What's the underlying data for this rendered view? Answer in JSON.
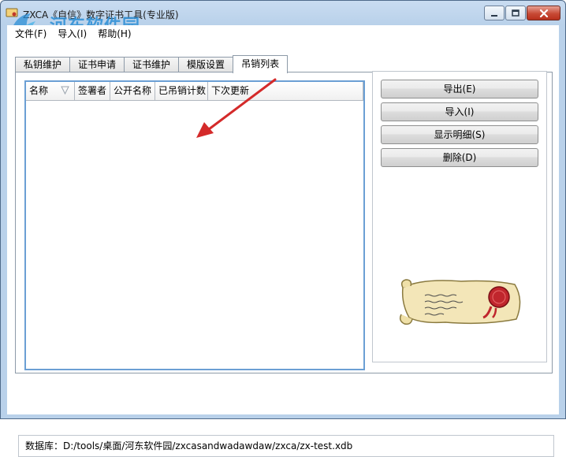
{
  "window": {
    "title": "ZXCA《自信》数字证书工具(专业版)",
    "watermark_name": "河东软件园",
    "watermark_url": "www.pc0359.cn"
  },
  "menu": {
    "items": [
      {
        "label": "文件(F)"
      },
      {
        "label": "导入(I)"
      },
      {
        "label": "帮助(H)"
      }
    ]
  },
  "tabs": [
    {
      "label": "私钥维护",
      "active": false
    },
    {
      "label": "证书申请",
      "active": false
    },
    {
      "label": "证书维护",
      "active": false
    },
    {
      "label": "模版设置",
      "active": false
    },
    {
      "label": "吊销列表",
      "active": true
    }
  ],
  "list": {
    "columns": [
      {
        "label": "名称"
      },
      {
        "label": "签署者"
      },
      {
        "label": "公开名称"
      },
      {
        "label": "已吊销计数"
      },
      {
        "label": "下次更新"
      }
    ],
    "rows": []
  },
  "actions": {
    "export_label": "导出(E)",
    "import_label": "导入(I)",
    "details_label": "显示明细(S)",
    "delete_label": "删除(D)"
  },
  "status": {
    "text": "数据库：D:/tools/桌面/河东软件园/zxcasandwadawdaw/zxca/zx-test.xdb"
  },
  "colors": {
    "accent_border": "#6b9fd4",
    "annotation_arrow": "#d42a2a",
    "close_button": "#c74a35",
    "watermark": "#2c8fd6"
  }
}
